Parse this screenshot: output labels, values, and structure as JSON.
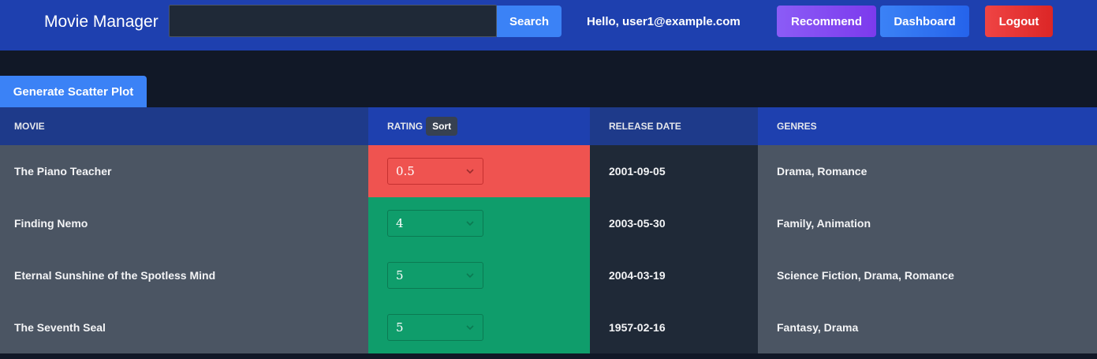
{
  "header": {
    "app_title": "Movie Manager",
    "search_value": "",
    "search_label": "Search",
    "greeting": "Hello, user1@example.com",
    "recommend_label": "Recommend",
    "dashboard_label": "Dashboard",
    "logout_label": "Logout"
  },
  "actions": {
    "scatter_label": "Generate Scatter Plot"
  },
  "table": {
    "headers": {
      "movie": "MOVIE",
      "rating": "RATING",
      "sort": "Sort",
      "release_date": "RELEASE DATE",
      "genres": "GENRES"
    },
    "rows": [
      {
        "movie": "The Piano Teacher",
        "rating": "0.5",
        "release_date": "2001-09-05",
        "genres": "Drama, Romance"
      },
      {
        "movie": "Finding Nemo",
        "rating": "4",
        "release_date": "2003-05-30",
        "genres": "Family, Animation"
      },
      {
        "movie": "Eternal Sunshine of the Spotless Mind",
        "rating": "5",
        "release_date": "2004-03-19",
        "genres": "Science Fiction, Drama, Romance"
      },
      {
        "movie": "The Seventh Seal",
        "rating": "5",
        "release_date": "1957-02-16",
        "genres": "Fantasy, Drama"
      }
    ]
  },
  "colors": {
    "navbar": "#1e40af",
    "background": "#111827",
    "low_rating": "#ef5350",
    "high_rating": "#0f9d6b"
  },
  "icons": {
    "select_arrow": "chevron-down-icon"
  }
}
